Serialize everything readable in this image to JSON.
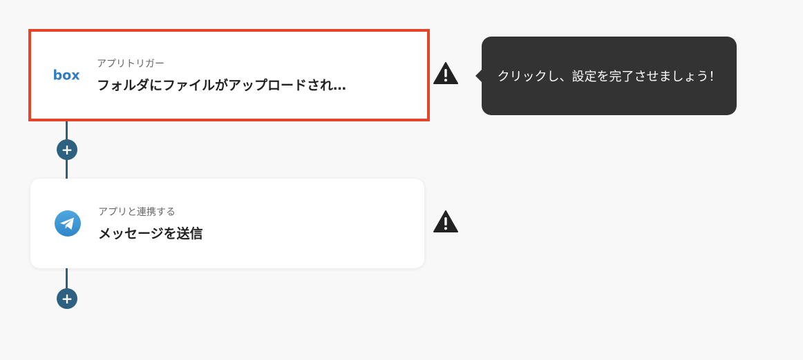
{
  "flow": {
    "steps": [
      {
        "app": "box",
        "logo_text": "box",
        "subtitle": "アプリトリガー",
        "title": "フォルダにファイルがアップロードされ…",
        "selected": true,
        "warning_icon": "warning-triangle-icon"
      },
      {
        "app": "telegram",
        "icon": "telegram-icon",
        "subtitle": "アプリと連携する",
        "title": "メッセージを送信",
        "selected": false,
        "warning_icon": "warning-triangle-icon"
      }
    ],
    "add_step_symbol": "+"
  },
  "tooltip": {
    "text": "クリックし、設定を完了させましょう！"
  },
  "colors": {
    "background": "#f8f8f8",
    "connector": "#2e6180",
    "selected_border": "#e5442c",
    "tooltip_bg": "#333333",
    "box_blue": "#2f7dc8",
    "telegram_blue": "#3a94d3"
  }
}
